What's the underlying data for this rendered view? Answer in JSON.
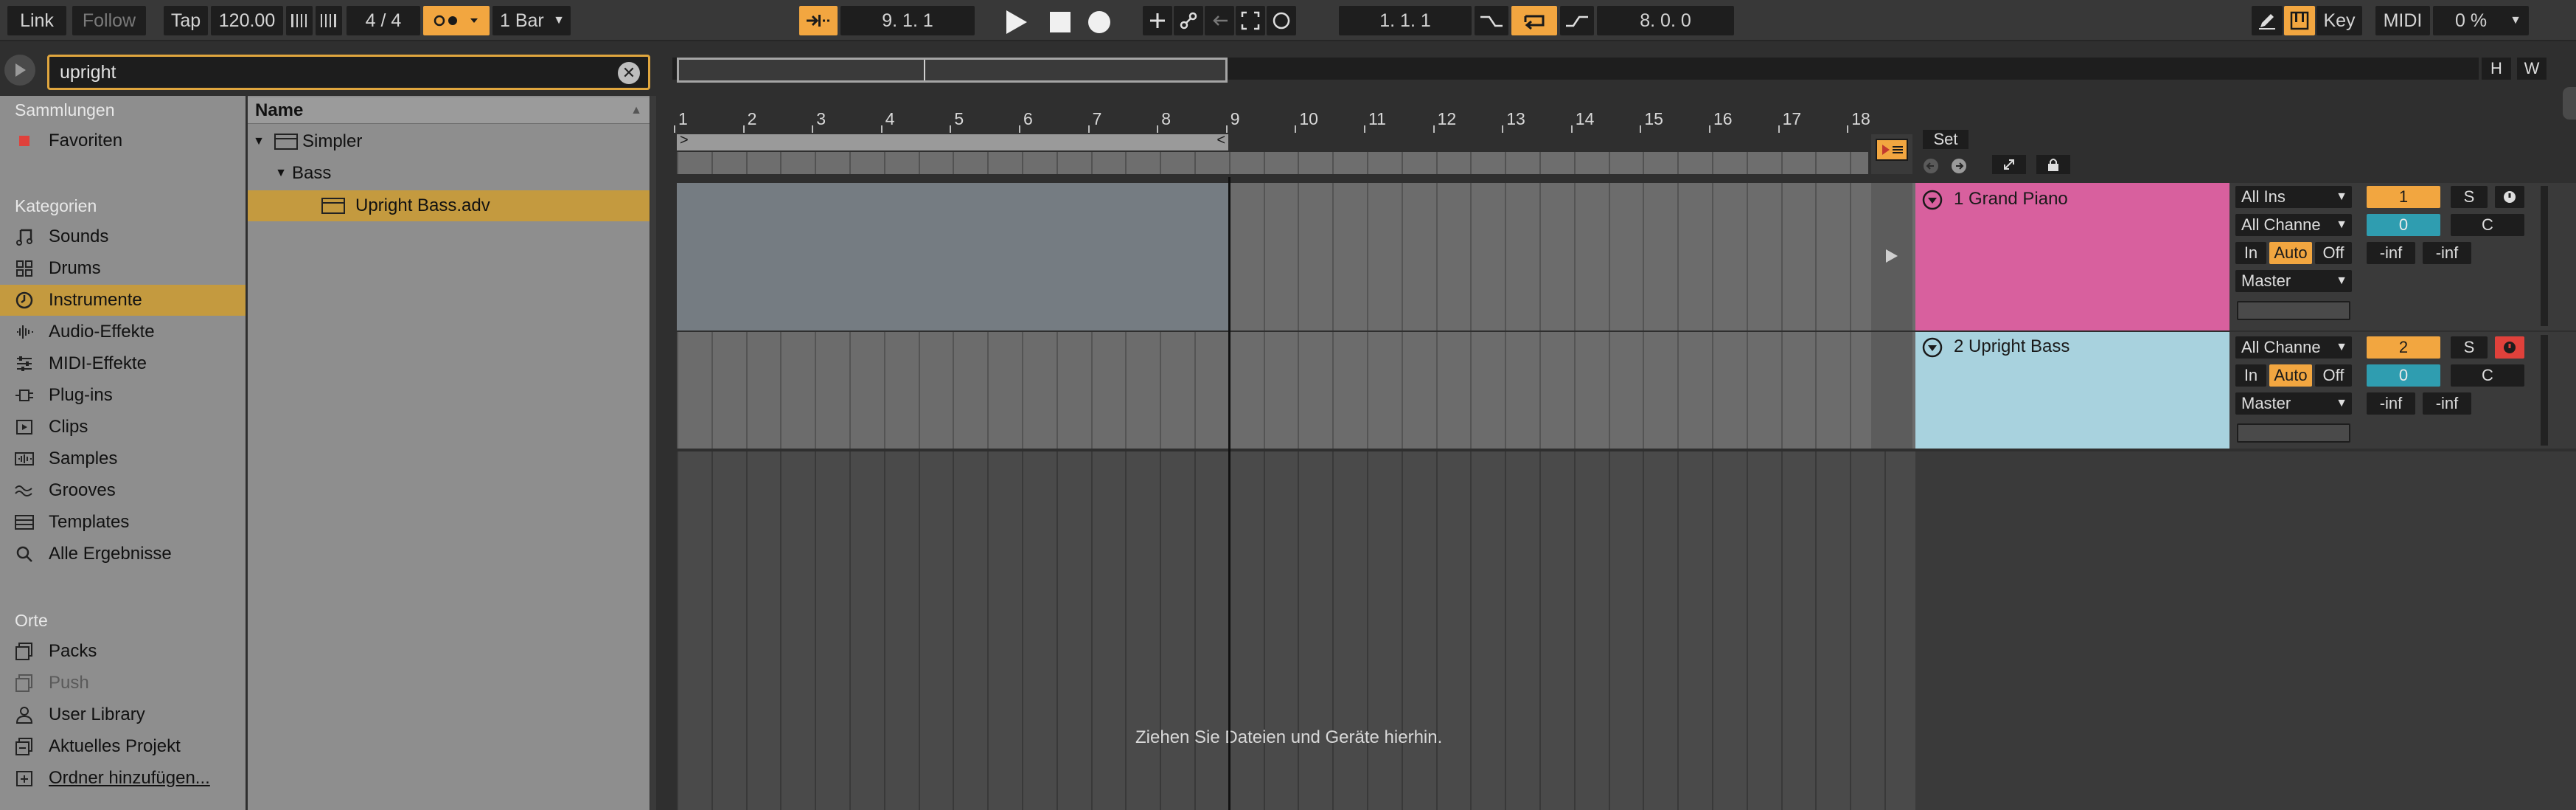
{
  "transport": {
    "link": "Link",
    "follow": "Follow",
    "tap": "Tap",
    "tempo": "120.00",
    "signature": "4 / 4",
    "quantize": "1 Bar",
    "position": "9.   1.   1",
    "loop_start": "1.   1.   1",
    "loop_length": "8.   0.   0",
    "key": "Key",
    "midi": "MIDI",
    "cpu": "0 %"
  },
  "browser": {
    "search_value": "upright",
    "sections": {
      "collections": "Sammlungen",
      "categories": "Kategorien",
      "places": "Orte"
    },
    "collections": [
      {
        "label": "Favoriten",
        "icon": "red-square-icon"
      }
    ],
    "categories": [
      {
        "label": "Sounds",
        "icon": "note-icon"
      },
      {
        "label": "Drums",
        "icon": "drums-grid-icon"
      },
      {
        "label": "Instrumente",
        "icon": "clock-instrument-icon",
        "selected": true
      },
      {
        "label": "Audio-Effekte",
        "icon": "waveform-icon"
      },
      {
        "label": "MIDI-Effekte",
        "icon": "midi-icon"
      },
      {
        "label": "Plug-ins",
        "icon": "plugin-icon"
      },
      {
        "label": "Clips",
        "icon": "clip-icon"
      },
      {
        "label": "Samples",
        "icon": "sample-icon"
      },
      {
        "label": "Grooves",
        "icon": "groove-icon"
      },
      {
        "label": "Templates",
        "icon": "template-icon"
      },
      {
        "label": "Alle Ergebnisse",
        "icon": "search-icon"
      }
    ],
    "places": [
      {
        "label": "Packs",
        "icon": "packs-icon"
      },
      {
        "label": "Push",
        "icon": "push-icon",
        "dim": true
      },
      {
        "label": "User Library",
        "icon": "user-icon"
      },
      {
        "label": "Aktuelles Projekt",
        "icon": "project-icon"
      },
      {
        "label": "Ordner hinzufügen...",
        "icon": "add-folder-icon",
        "underline": true
      }
    ],
    "list_header": "Name",
    "list": [
      {
        "label": "Simpler",
        "level": 0,
        "expanded": true,
        "icon": "device-icon"
      },
      {
        "label": "Bass",
        "level": 1,
        "expanded": true
      },
      {
        "label": "Upright Bass.adv",
        "level": 2,
        "icon": "device-icon",
        "selected": true
      }
    ]
  },
  "arrangement": {
    "ruler": [
      "1",
      "2",
      "3",
      "4",
      "5",
      "6",
      "7",
      "8",
      "9",
      "10",
      "11",
      "12",
      "13",
      "14",
      "15",
      "16",
      "17",
      "18"
    ],
    "set_label": "Set",
    "drop_hint": "Ziehen Sie Dateien und Geräte hierhin.",
    "overview_buttons": [
      "H",
      "W"
    ]
  },
  "tracks": [
    {
      "name": "1 Grand Piano",
      "color": "#d8609e",
      "input": "All Ins",
      "channel": "All Channe",
      "monitor": [
        "In",
        "Auto",
        "Off"
      ],
      "output": "Master",
      "number": "1",
      "solo": "S",
      "volume": "0",
      "pan": "C",
      "meters": [
        "-inf",
        "-inf"
      ]
    },
    {
      "name": "2 Upright Bass",
      "color": "#a8d2de",
      "channel": "All Channe",
      "monitor": [
        "In",
        "Auto",
        "Off"
      ],
      "output": "Master",
      "number": "2",
      "solo": "S",
      "volume": "0",
      "pan": "C",
      "meters": [
        "-inf",
        "-inf"
      ]
    }
  ],
  "colors": {
    "accent": "#f2a640",
    "selection": "#c49a3f",
    "record_red": "#e0413b",
    "teal": "#2f9db0"
  }
}
